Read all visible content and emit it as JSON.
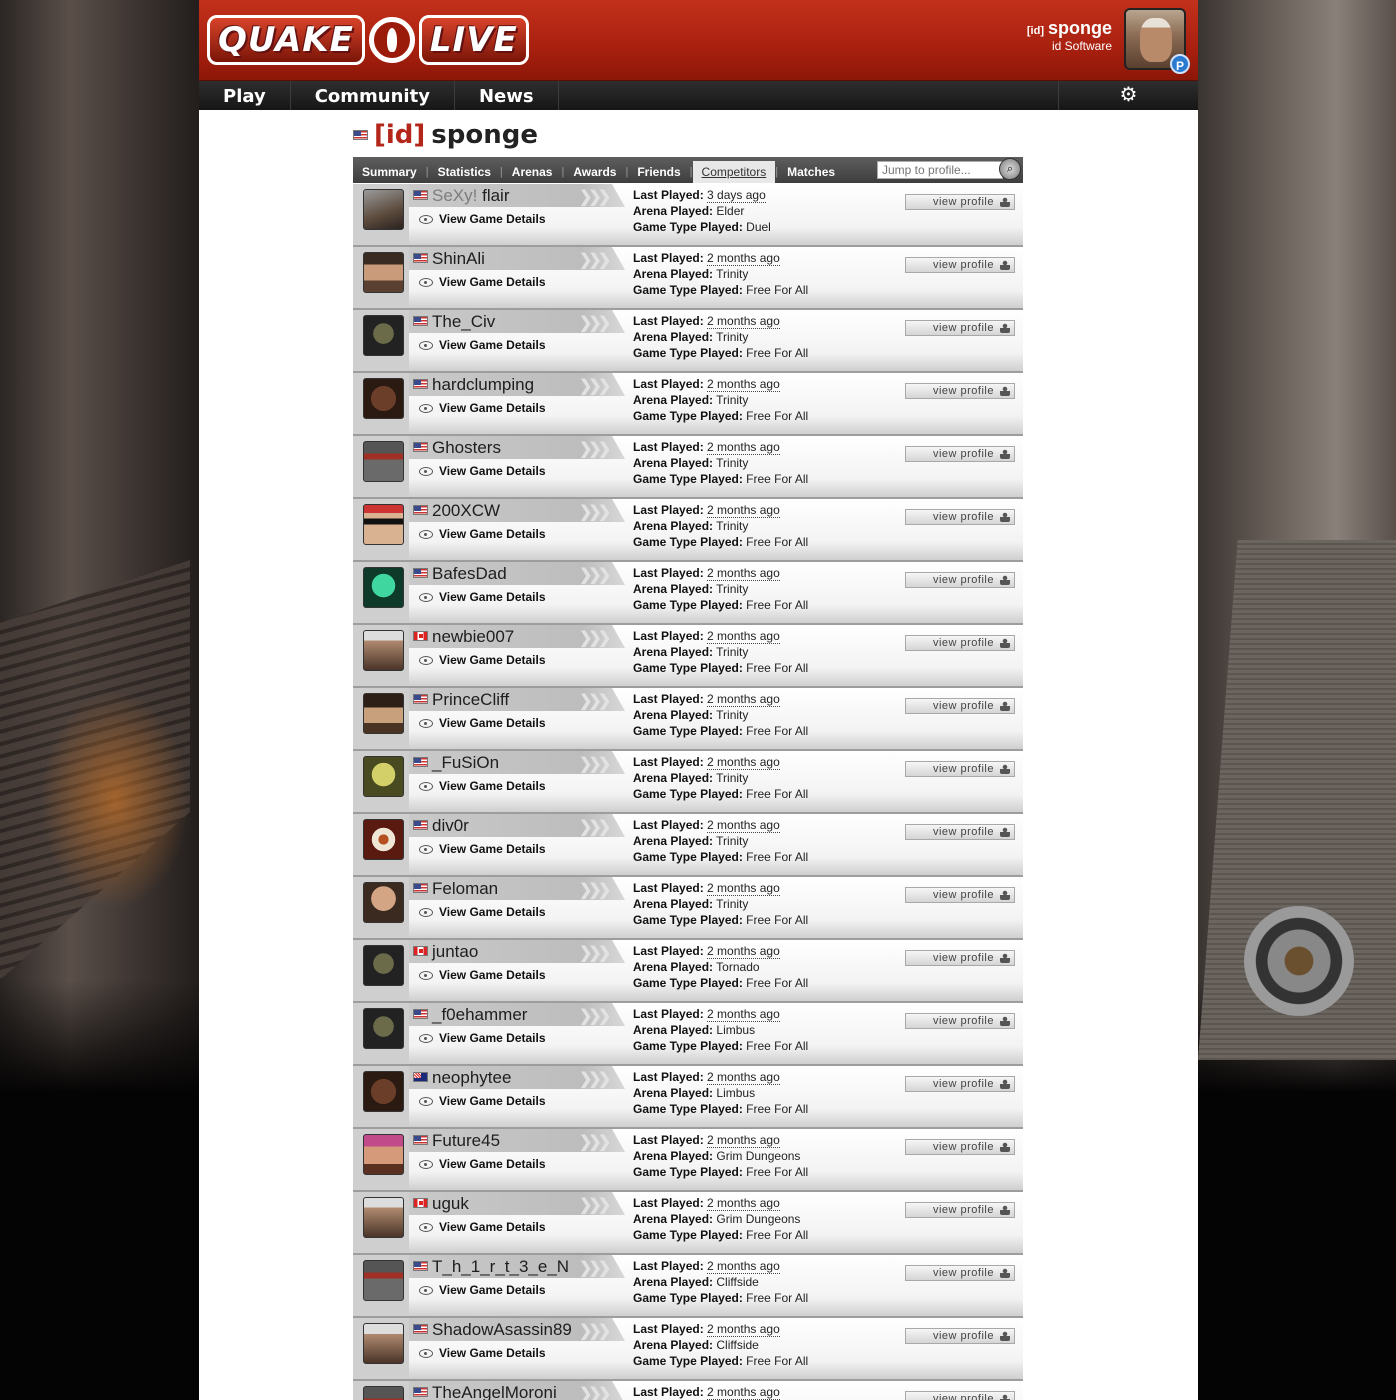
{
  "header": {
    "logo_text_left": "QUAKE",
    "logo_text_right": "LIVE",
    "user_clan": "[id]",
    "user_name": "sponge",
    "user_team": "id Software",
    "user_badge": "P"
  },
  "nav": {
    "items": [
      "Play",
      "Community",
      "News"
    ],
    "settings_icon": "gear-icon"
  },
  "profile": {
    "clan": "[id]",
    "name": "sponge",
    "flag": "us"
  },
  "tabs": {
    "items": [
      {
        "label": "Summary",
        "active": false
      },
      {
        "label": "Statistics",
        "active": false
      },
      {
        "label": "Arenas",
        "active": false
      },
      {
        "label": "Awards",
        "active": false
      },
      {
        "label": "Friends",
        "active": false
      },
      {
        "label": "Competitors",
        "active": true
      },
      {
        "label": "Matches",
        "active": false
      }
    ],
    "separator": "|",
    "search_placeholder": "Jump to profile..."
  },
  "labels": {
    "view_game_details": "View Game Details",
    "last_played": "Last Played:",
    "arena_played": "Arena Played:",
    "game_type_played": "Game Type Played:",
    "view_profile": "view profile"
  },
  "competitors": [
    {
      "clan": "SeXy!",
      "name": "flair",
      "flag": "us",
      "avatar": "av-1",
      "last_played": "3 days ago",
      "arena": "Elder",
      "game_type": "Duel"
    },
    {
      "clan": "",
      "name": "ShinAli",
      "flag": "us",
      "avatar": "av-2",
      "last_played": "2 months ago",
      "arena": "Trinity",
      "game_type": "Free For All"
    },
    {
      "clan": "",
      "name": "The_Civ",
      "flag": "us",
      "avatar": "av-3",
      "last_played": "2 months ago",
      "arena": "Trinity",
      "game_type": "Free For All"
    },
    {
      "clan": "",
      "name": "hardclumping",
      "flag": "us",
      "avatar": "av-4",
      "last_played": "2 months ago",
      "arena": "Trinity",
      "game_type": "Free For All"
    },
    {
      "clan": "",
      "name": "Ghosters",
      "flag": "us",
      "avatar": "av-5",
      "last_played": "2 months ago",
      "arena": "Trinity",
      "game_type": "Free For All"
    },
    {
      "clan": "",
      "name": "200XCW",
      "flag": "us",
      "avatar": "av-6",
      "last_played": "2 months ago",
      "arena": "Trinity",
      "game_type": "Free For All"
    },
    {
      "clan": "",
      "name": "BafesDad",
      "flag": "us",
      "avatar": "av-7",
      "last_played": "2 months ago",
      "arena": "Trinity",
      "game_type": "Free For All"
    },
    {
      "clan": "",
      "name": "newbie007",
      "flag": "ca",
      "avatar": "av-8",
      "last_played": "2 months ago",
      "arena": "Trinity",
      "game_type": "Free For All"
    },
    {
      "clan": "",
      "name": "PrinceCliff",
      "flag": "us",
      "avatar": "av-9",
      "last_played": "2 months ago",
      "arena": "Trinity",
      "game_type": "Free For All"
    },
    {
      "clan": "",
      "name": "_FuSiOn",
      "flag": "us",
      "avatar": "av-10",
      "last_played": "2 months ago",
      "arena": "Trinity",
      "game_type": "Free For All"
    },
    {
      "clan": "",
      "name": "div0r",
      "flag": "us",
      "avatar": "av-11",
      "last_played": "2 months ago",
      "arena": "Trinity",
      "game_type": "Free For All"
    },
    {
      "clan": "",
      "name": "Feloman",
      "flag": "us",
      "avatar": "av-12",
      "last_played": "2 months ago",
      "arena": "Trinity",
      "game_type": "Free For All"
    },
    {
      "clan": "",
      "name": "juntao",
      "flag": "ca",
      "avatar": "av-3",
      "last_played": "2 months ago",
      "arena": "Tornado",
      "game_type": "Free For All"
    },
    {
      "clan": "",
      "name": "_f0ehammer",
      "flag": "us",
      "avatar": "av-3",
      "last_played": "2 months ago",
      "arena": "Limbus",
      "game_type": "Free For All"
    },
    {
      "clan": "",
      "name": "neophytee",
      "flag": "au",
      "avatar": "av-4",
      "last_played": "2 months ago",
      "arena": "Limbus",
      "game_type": "Free For All"
    },
    {
      "clan": "",
      "name": "Future45",
      "flag": "us",
      "avatar": "av-13",
      "last_played": "2 months ago",
      "arena": "Grim Dungeons",
      "game_type": "Free For All"
    },
    {
      "clan": "",
      "name": "uguk",
      "flag": "ca",
      "avatar": "av-8",
      "last_played": "2 months ago",
      "arena": "Grim Dungeons",
      "game_type": "Free For All"
    },
    {
      "clan": "",
      "name": "T_h_1_r_t_3_e_N",
      "flag": "us",
      "avatar": "av-5",
      "last_played": "2 months ago",
      "arena": "Cliffside",
      "game_type": "Free For All"
    },
    {
      "clan": "",
      "name": "ShadowAsassin89",
      "flag": "us",
      "avatar": "av-8",
      "last_played": "2 months ago",
      "arena": "Cliffside",
      "game_type": "Free For All"
    },
    {
      "clan": "",
      "name": "TheAngelMoroni",
      "flag": "us",
      "avatar": "av-5",
      "last_played": "2 months ago",
      "arena": "",
      "game_type": ""
    }
  ]
}
